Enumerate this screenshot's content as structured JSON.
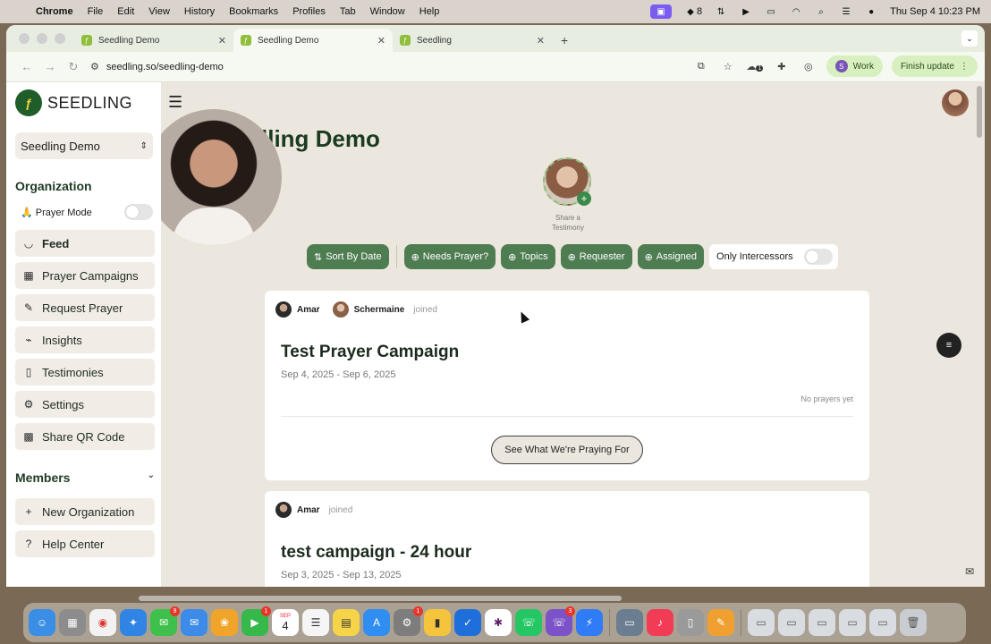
{
  "menubar": {
    "items": [
      "Chrome",
      "File",
      "Edit",
      "View",
      "History",
      "Bookmarks",
      "Profiles",
      "Tab",
      "Window",
      "Help"
    ],
    "notif_count": "8",
    "clock": "Thu Sep 4  10:23 PM"
  },
  "browser": {
    "tabs": [
      {
        "title": "Seedling Demo"
      },
      {
        "title": "Seedling Demo"
      },
      {
        "title": "Seedling"
      }
    ],
    "new_tab": "+",
    "url": "seedling.so/seedling-demo",
    "ext_badge": "1",
    "profile_initial": "S",
    "profile_label": "Work",
    "update_label": "Finish update"
  },
  "sidebar": {
    "brand": "SEEDLING",
    "org_selected": "Seedling Demo",
    "organization_title": "Organization",
    "prayer_mode": "🙏 Prayer Mode",
    "nav": [
      {
        "label": "Feed",
        "icon": "rss-icon"
      },
      {
        "label": "Prayer Campaigns",
        "icon": "calendar-icon"
      },
      {
        "label": "Request Prayer",
        "icon": "edit-icon"
      },
      {
        "label": "Insights",
        "icon": "chart-icon"
      },
      {
        "label": "Testimonies",
        "icon": "book-icon"
      },
      {
        "label": "Settings",
        "icon": "gear-icon"
      },
      {
        "label": "Share QR Code",
        "icon": "qr-icon"
      }
    ],
    "members_title": "Members",
    "new_org": "New Organization",
    "help": "Help Center"
  },
  "main": {
    "title": "lling Demo",
    "testimony_label": "Share a Testimony",
    "filters": [
      "Sort By Date",
      "Needs Prayer?",
      "Topics",
      "Requester",
      "Assigned"
    ],
    "only_intercessors": "Only Intercessors",
    "cards": [
      {
        "users": [
          "Amar",
          "Schermaine"
        ],
        "joined": "joined",
        "title": "Test Prayer Campaign",
        "dates": "Sep 4, 2025 - Sep 6, 2025",
        "status": "No prayers yet",
        "cta": "See What We're Praying For"
      },
      {
        "users": [
          "Amar"
        ],
        "joined": "joined",
        "title": "test campaign - 24 hour",
        "dates": "Sep 3, 2025 - Sep 13, 2025"
      }
    ]
  },
  "dock": {
    "badges": [
      "9",
      "1",
      "1",
      "3"
    ],
    "calendar_day": "4",
    "calendar_month": "SEP"
  },
  "colors": {
    "brand_green": "#1f5d2a",
    "filter_green": "#4f7d52",
    "page_bg": "#ece7de"
  }
}
